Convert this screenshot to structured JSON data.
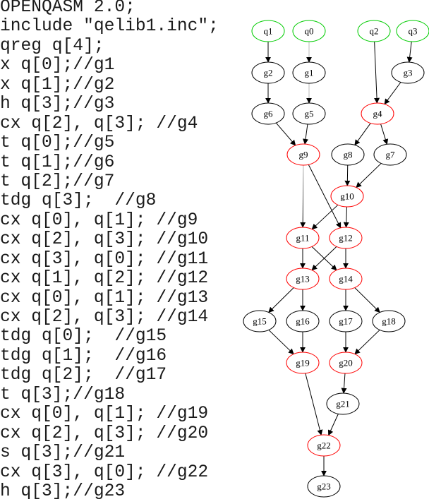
{
  "code": {
    "lines": [
      "OPENQASM 2.0;",
      "include \"qelib1.inc\";",
      "qreg q[4];",
      "x q[0];//g1",
      "x q[1];//g2",
      "h q[3];//g3",
      "cx q[2], q[3]; //g4",
      "t q[0];//g5",
      "t q[1];//g6",
      "t q[2];//g7",
      "tdg q[3];  //g8",
      "cx q[0], q[1]; //g9",
      "cx q[2], q[3]; //g10",
      "cx q[3], q[0]; //g11",
      "cx q[1], q[2]; //g12",
      "cx q[0], q[1]; //g13",
      "cx q[2], q[3]; //g14",
      "tdg q[0];  //g15",
      "tdg q[1];  //g16",
      "tdg q[2];  //g17",
      "t q[3];//g18",
      "cx q[0], q[1]; //g19",
      "cx q[2], q[3]; //g20",
      "s q[3];//g21",
      "cx q[3], q[0]; //g22",
      "h q[3];//g23"
    ]
  },
  "graph": {
    "colors": {
      "input": "#00cc00",
      "two_qubit": "#ff0000",
      "single_qubit": "#000000",
      "edge": "#000000",
      "edge_faded": "#bbbbbb"
    },
    "nodes": [
      {
        "id": "q1",
        "label": "q1",
        "kind": "input"
      },
      {
        "id": "q0",
        "label": "q0",
        "kind": "input"
      },
      {
        "id": "q2",
        "label": "q2",
        "kind": "input"
      },
      {
        "id": "q3",
        "label": "q3",
        "kind": "input"
      },
      {
        "id": "g2",
        "label": "g2",
        "kind": "single_qubit"
      },
      {
        "id": "g1",
        "label": "g1",
        "kind": "single_qubit"
      },
      {
        "id": "g3",
        "label": "g3",
        "kind": "single_qubit"
      },
      {
        "id": "g6",
        "label": "g6",
        "kind": "single_qubit"
      },
      {
        "id": "g5",
        "label": "g5",
        "kind": "single_qubit"
      },
      {
        "id": "g4",
        "label": "g4",
        "kind": "two_qubit"
      },
      {
        "id": "g9",
        "label": "g9",
        "kind": "two_qubit"
      },
      {
        "id": "g8",
        "label": "g8",
        "kind": "single_qubit"
      },
      {
        "id": "g7",
        "label": "g7",
        "kind": "single_qubit"
      },
      {
        "id": "g10",
        "label": "g10",
        "kind": "two_qubit"
      },
      {
        "id": "g11",
        "label": "g11",
        "kind": "two_qubit"
      },
      {
        "id": "g12",
        "label": "g12",
        "kind": "two_qubit"
      },
      {
        "id": "g13",
        "label": "g13",
        "kind": "two_qubit"
      },
      {
        "id": "g14",
        "label": "g14",
        "kind": "two_qubit"
      },
      {
        "id": "g15",
        "label": "g15",
        "kind": "single_qubit"
      },
      {
        "id": "g16",
        "label": "g16",
        "kind": "single_qubit"
      },
      {
        "id": "g17",
        "label": "g17",
        "kind": "single_qubit"
      },
      {
        "id": "g18",
        "label": "g18",
        "kind": "single_qubit"
      },
      {
        "id": "g19",
        "label": "g19",
        "kind": "two_qubit"
      },
      {
        "id": "g20",
        "label": "g20",
        "kind": "two_qubit"
      },
      {
        "id": "g21",
        "label": "g21",
        "kind": "single_qubit"
      },
      {
        "id": "g22",
        "label": "g22",
        "kind": "two_qubit"
      },
      {
        "id": "g23",
        "label": "g23",
        "kind": "single_qubit"
      }
    ],
    "edges": [
      {
        "from": "q1",
        "to": "g2"
      },
      {
        "from": "q0",
        "to": "g1",
        "faded": true
      },
      {
        "from": "q2",
        "to": "g4"
      },
      {
        "from": "q3",
        "to": "g3"
      },
      {
        "from": "g2",
        "to": "g6"
      },
      {
        "from": "g1",
        "to": "g5",
        "faded": true
      },
      {
        "from": "g3",
        "to": "g4"
      },
      {
        "from": "g6",
        "to": "g9"
      },
      {
        "from": "g5",
        "to": "g9"
      },
      {
        "from": "g4",
        "to": "g8"
      },
      {
        "from": "g4",
        "to": "g7"
      },
      {
        "from": "g8",
        "to": "g10"
      },
      {
        "from": "g7",
        "to": "g10"
      },
      {
        "from": "g9",
        "to": "g11",
        "faded": true
      },
      {
        "from": "g9",
        "to": "g12"
      },
      {
        "from": "g10",
        "to": "g11"
      },
      {
        "from": "g10",
        "to": "g12"
      },
      {
        "from": "g11",
        "to": "g13"
      },
      {
        "from": "g11",
        "to": "g14"
      },
      {
        "from": "g12",
        "to": "g13"
      },
      {
        "from": "g12",
        "to": "g14"
      },
      {
        "from": "g13",
        "to": "g15"
      },
      {
        "from": "g13",
        "to": "g16"
      },
      {
        "from": "g14",
        "to": "g17"
      },
      {
        "from": "g14",
        "to": "g18"
      },
      {
        "from": "g15",
        "to": "g19"
      },
      {
        "from": "g16",
        "to": "g19"
      },
      {
        "from": "g17",
        "to": "g20"
      },
      {
        "from": "g18",
        "to": "g20"
      },
      {
        "from": "g19",
        "to": "g22"
      },
      {
        "from": "g20",
        "to": "g21"
      },
      {
        "from": "g21",
        "to": "g22"
      },
      {
        "from": "g22",
        "to": "g23"
      }
    ]
  }
}
